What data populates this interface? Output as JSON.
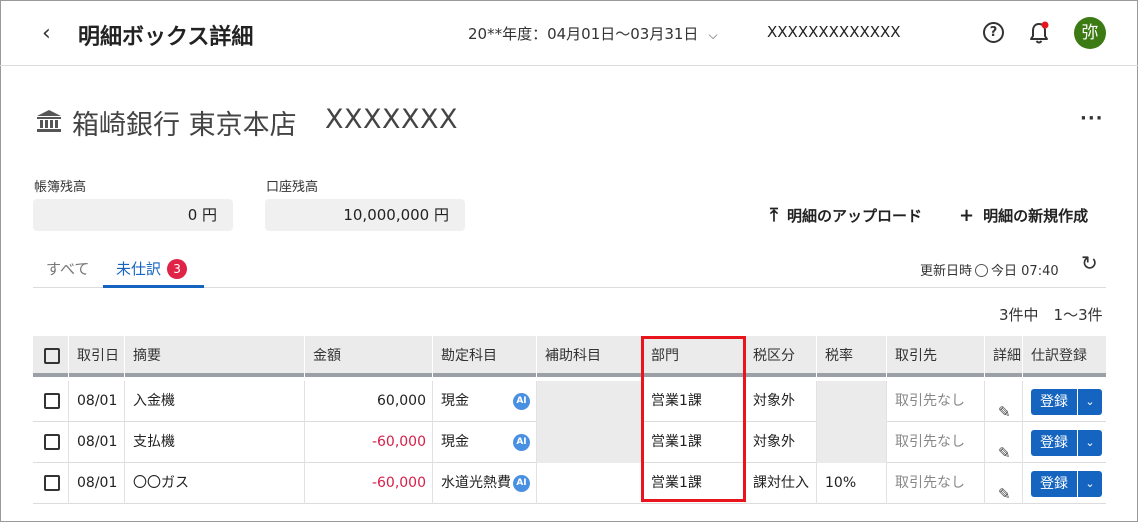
{
  "header": {
    "back_icon": "chevron-left-icon",
    "title": "明細ボックス詳細",
    "period": "20**年度：04月01日〜03月31日",
    "company": "XXXXXXXXXXXXX",
    "help_icon": "question-circle-icon",
    "help_glyph": "?",
    "bell_icon": "bell-icon",
    "avatar": "弥",
    "avatar_color": "#3c7a14"
  },
  "bank": {
    "icon": "bank-icon",
    "name": "箱崎銀行 東京本店",
    "account": "XXXXXXX",
    "more": "···"
  },
  "balances": {
    "book_label": "帳簿残高",
    "book_value": "0 円",
    "account_label": "口座残高",
    "account_value": "10,000,000 円"
  },
  "actions": {
    "upload_label": "明細のアップロード",
    "create_label": "明細の新規作成"
  },
  "tabs": {
    "all_label": "すべて",
    "unposted_label": "未仕訳",
    "unposted_count": "3"
  },
  "updated": {
    "label": "更新日時",
    "value": "今日 07:40"
  },
  "pagination": {
    "text": "3件中　1〜3件"
  },
  "table": {
    "headers": [
      "取引日",
      "摘要",
      "金額",
      "勘定科目",
      "補助科目",
      "部門",
      "税区分",
      "税率",
      "取引先",
      "詳細",
      "仕訳登録"
    ],
    "rows": [
      {
        "date": "08/01",
        "summary": "入金機",
        "amount": "60,000",
        "account": "現金",
        "sub": "",
        "dept": "営業1課",
        "tax": "対象外",
        "rate": "",
        "partner": "取引先なし",
        "register": "登録"
      },
      {
        "date": "08/01",
        "summary": "支払機",
        "amount": "-60,000",
        "account": "現金",
        "sub": "",
        "dept": "営業1課",
        "tax": "対象外",
        "rate": "",
        "partner": "取引先なし",
        "register": "登録"
      },
      {
        "date": "08/01",
        "summary": "〇〇ガス",
        "amount": "-60,000",
        "account": "水道光熱費",
        "sub": "",
        "dept": "営業1課",
        "tax": "課対仕入",
        "rate": "10%",
        "partner": "取引先なし",
        "register": "登録"
      }
    ],
    "ai_badge": "AI"
  },
  "colors": {
    "accent": "#1565c0",
    "negative": "#d6204a",
    "badge": "#e02448",
    "highlight": "#e8151c"
  }
}
